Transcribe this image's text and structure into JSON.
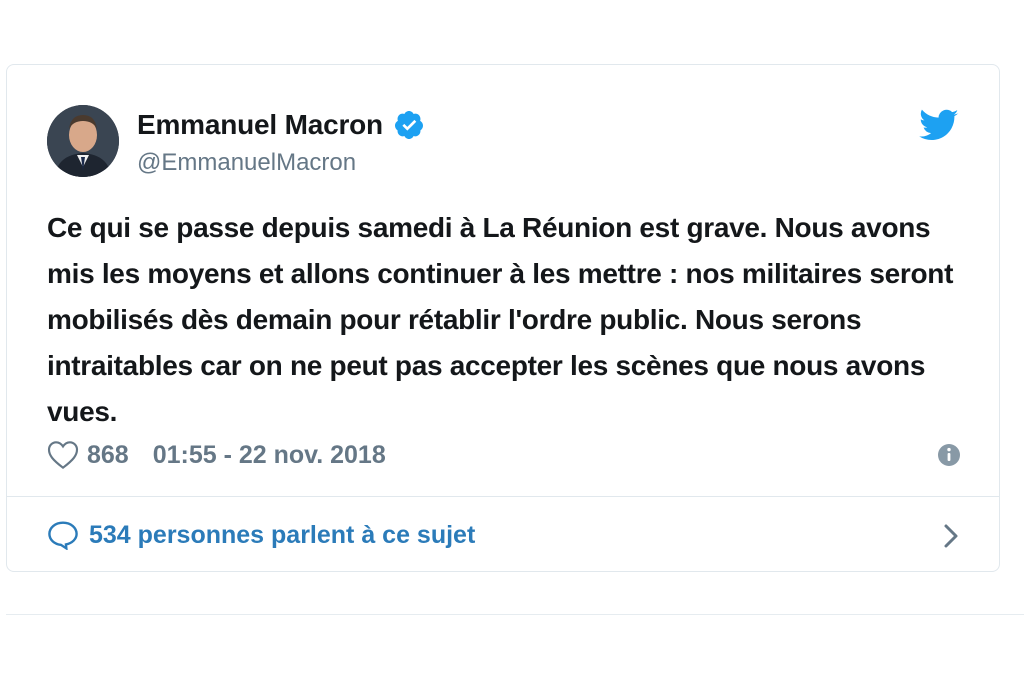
{
  "tweet": {
    "author_name": "Emmanuel Macron",
    "author_handle": "@EmmanuelMacron",
    "verified": true,
    "text": "Ce qui se passe depuis samedi à La Réunion est grave. Nous avons mis les moyens et allons continuer à les mettre : nos militaires seront mobilisés dès demain pour rétablir l'ordre public. Nous serons intraitables car on ne peut pas accepter les scènes que nous avons vues.",
    "like_count": "868",
    "timestamp": "01:55 - 22 nov. 2018",
    "conversation_label": "534 personnes parlent à ce sujet"
  },
  "icons": {
    "verified": "verified-badge-icon",
    "brand": "twitter-bird-icon",
    "like": "heart-icon",
    "info": "info-icon",
    "reply": "comment-bubble-icon",
    "chevron": "chevron-right-icon"
  },
  "colors": {
    "twitter_blue": "#1da1f2",
    "link_blue": "#2b7bb9",
    "text_primary": "#14171a",
    "text_secondary": "#657786",
    "border": "#e1e8ed"
  }
}
